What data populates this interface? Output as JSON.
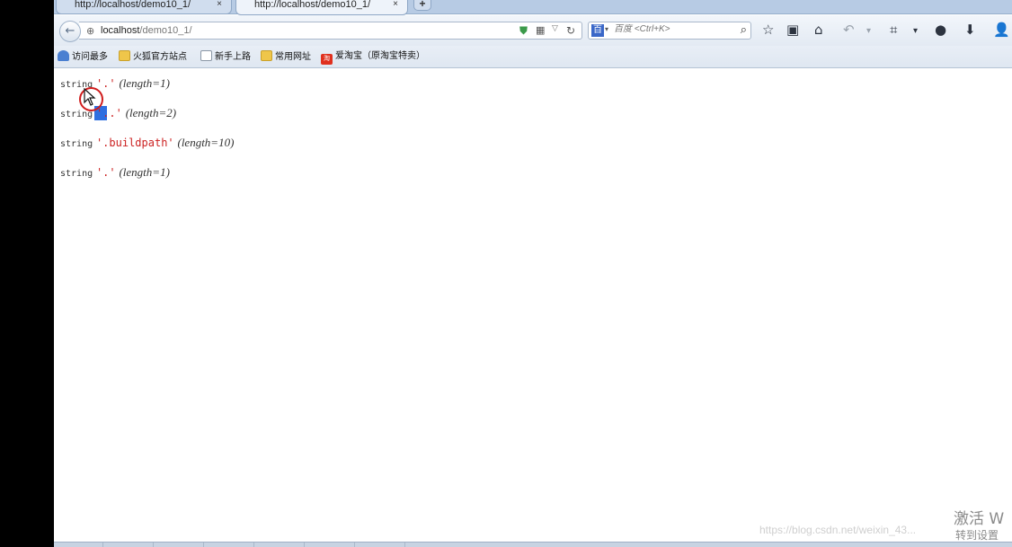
{
  "tabs": [
    {
      "label": "http://localhost/demo10_1/",
      "active": false,
      "close": "×"
    },
    {
      "label": "http://localhost/demo10_1/",
      "active": true,
      "close": "×"
    }
  ],
  "new_tab": "+",
  "nav": {
    "back_icon": "←",
    "url_host": "localhost",
    "url_path": "/demo10_1/",
    "search_engine": "百",
    "search_placeholder": "百度 <Ctrl+K>",
    "search_go": "⌕",
    "toolbar_icons": [
      "star-icon",
      "clipboard-icon",
      "home-icon",
      "undo-icon",
      "crop-icon",
      "chat-icon",
      "download-icon",
      "user-icon"
    ]
  },
  "bookmarks": [
    {
      "label": "访问最多",
      "icon": "person"
    },
    {
      "label": "火狐官方站点",
      "icon": "folder"
    },
    {
      "label": "新手上路",
      "icon": "page"
    },
    {
      "label": "常用网址",
      "icon": "folder"
    },
    {
      "label": "爱淘宝（原淘宝特卖）",
      "icon": "brand"
    }
  ],
  "dump": [
    {
      "type": "string",
      "value": "'.'",
      "length": "(length=1)"
    },
    {
      "type": "string",
      "value": "'..'",
      "length": "(length=2)"
    },
    {
      "type": "string",
      "value": "'.buildpath'",
      "length": "(length=10)"
    },
    {
      "type": "string",
      "value": "'.'",
      "length": "(length=1)"
    }
  ],
  "watermark": {
    "url": "https://blog.csdn.net/weixin_43...",
    "activate": "激活 W",
    "activate_sub": "转到设置"
  },
  "colors": {
    "value_red": "#cc2222",
    "tab_bar": "#b7cbe4",
    "cursor_ring": "#d01c1c"
  }
}
